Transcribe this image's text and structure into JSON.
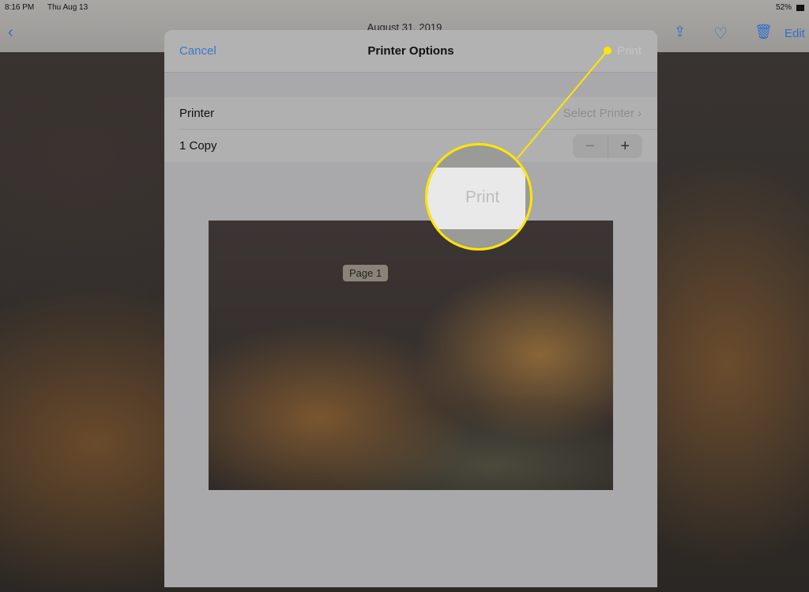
{
  "status": {
    "time": "8:16 PM",
    "date": "Thu Aug 13",
    "battery": "52%"
  },
  "nav": {
    "title": "August 31, 2019",
    "edit": "Edit",
    "icons": [
      "chevron-left-icon",
      "share-icon",
      "heart-icon",
      "trash-icon"
    ]
  },
  "sheet": {
    "cancel": "Cancel",
    "title": "Printer Options",
    "print": "Print",
    "printer_label": "Printer",
    "printer_value": "Select Printer",
    "copies": "1 Copy",
    "minus": "−",
    "plus": "+",
    "page_label": "Page 1"
  },
  "callout": {
    "text": "Print",
    "color": "#ffe600"
  }
}
